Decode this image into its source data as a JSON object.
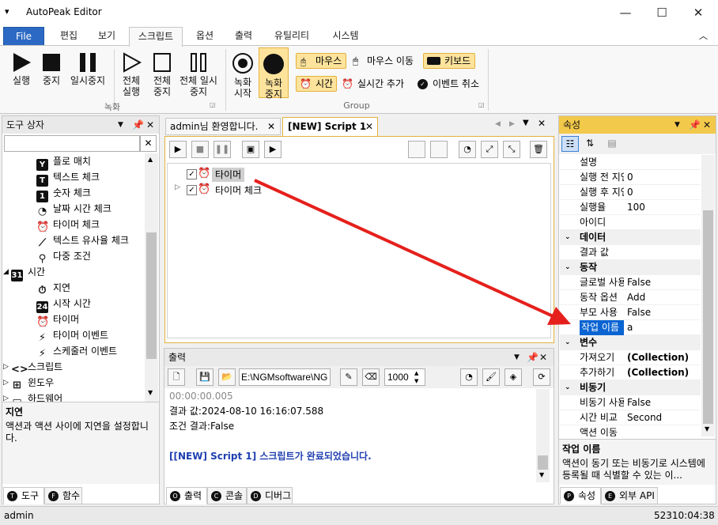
{
  "window": {
    "title": "AutoPeak Editor",
    "min": "—",
    "max": "☐",
    "close": "✕",
    "sysmenu": "▾"
  },
  "ribbon_tabs": [
    "File",
    "편집",
    "보기",
    "스크립트",
    "옵션",
    "출력",
    "유틸리티",
    "시스템"
  ],
  "ribbon": {
    "record_group": "녹화",
    "group2": "Group",
    "buttons": {
      "run": "실행",
      "stop": "중지",
      "pause": "일시중지",
      "all_run": "전체 실행",
      "all_stop": "전체 중지",
      "all_pause": "전체 일시중지",
      "rec_start": "녹화 시작",
      "rec_stop": "녹화 중지"
    },
    "mouse_click": "마우스",
    "mouse_move": "마우스 이동",
    "keyboard": "키보드",
    "time": "시간",
    "realtime_add": "실시간 추가",
    "event_cancel": "이벤트 취소",
    "collapse": "︿"
  },
  "toolbox": {
    "title": "도구 상자",
    "search_value": "",
    "items": [
      {
        "label": "플로 매치",
        "icon": "Y",
        "lv": 2
      },
      {
        "label": "텍스트 체크",
        "icon": "T",
        "lv": 2
      },
      {
        "label": "숫자 체크",
        "icon": "1",
        "lv": 2
      },
      {
        "label": "날짜 시간 체크",
        "icon": "clock",
        "lv": 2
      },
      {
        "label": "타이머 체크",
        "icon": "alarm",
        "lv": 2
      },
      {
        "label": "텍스트 유사율 체크",
        "icon": "sim",
        "lv": 2
      },
      {
        "label": "다중 조건",
        "icon": "multi",
        "lv": 2
      },
      {
        "label": "시간",
        "icon": "31",
        "lv": 1,
        "exp": "◢"
      },
      {
        "label": "지연",
        "icon": "stopwatch",
        "lv": 2
      },
      {
        "label": "시작 시간",
        "icon": "24",
        "lv": 2
      },
      {
        "label": "타이머",
        "icon": "alarm",
        "lv": 2
      },
      {
        "label": "타이머 이벤트",
        "icon": "bolt",
        "lv": 2
      },
      {
        "label": "스케줄러 이벤트",
        "icon": "bolt",
        "lv": 2
      },
      {
        "label": "스크립트",
        "icon": "code",
        "lv": 1,
        "exp": "▷"
      },
      {
        "label": "윈도우",
        "icon": "win",
        "lv": 1,
        "exp": "▷"
      },
      {
        "label": "하드웨어",
        "icon": "hw",
        "lv": 1,
        "exp": "▷"
      }
    ],
    "desc_title": "지연",
    "desc_text": "액션과 액션 사이에 지연을 설정합니다.",
    "tabs": [
      "도구",
      "함수"
    ]
  },
  "doc_tabs": [
    "admin님 환영합니다.",
    "[NEW] Script 1"
  ],
  "script_tree": [
    {
      "label": "타이머",
      "sel": true
    },
    {
      "label": "타이머 체크",
      "sel": false
    }
  ],
  "output": {
    "title": "출력",
    "path": "E:\\NGMsoftware\\NG",
    "spin": "1000",
    "lines": [
      "00:00:00.005",
      "결과 값:2024-08-10 16:16:07.588",
      "조건 결과:False",
      "",
      "[[NEW] Script 1] 스크립트가 완료되었습니다."
    ],
    "tabs": [
      "출력",
      "콘솔",
      "디버그"
    ]
  },
  "props": {
    "title": "속성",
    "rows": [
      {
        "k": "설명",
        "v": ""
      },
      {
        "k": "실행 전 지연",
        "v": "0"
      },
      {
        "k": "실행 후 지연",
        "v": "0"
      },
      {
        "k": "실행율",
        "v": "100"
      },
      {
        "k": "아이디",
        "v": ""
      },
      {
        "cat": "데이터"
      },
      {
        "k": "결과 값",
        "v": ""
      },
      {
        "cat": "동작"
      },
      {
        "k": "글로벌 사용",
        "v": "False"
      },
      {
        "k": "동작 옵션",
        "v": "Add"
      },
      {
        "k": "부모 사용",
        "v": "False"
      },
      {
        "k": "작업 이름",
        "v": "a",
        "sel": true
      },
      {
        "cat": "변수"
      },
      {
        "k": "가져오기",
        "v": "(Collection)",
        "b": true
      },
      {
        "k": "추가하기",
        "v": "(Collection)",
        "b": true
      },
      {
        "cat": "비동기"
      },
      {
        "k": "비동기 사용",
        "v": "False"
      },
      {
        "k": "시간 비교",
        "v": "Second"
      },
      {
        "k": "액션 이동",
        "v": ""
      }
    ],
    "desc_title": "작업 이름",
    "desc_text": "액션이 동기 또는 비동기로 시스템에 등록될 때 식별할 수 있는 이...",
    "tabs": [
      "속성",
      "외부 API"
    ]
  },
  "status": {
    "user": "admin",
    "code": "52310:04:38"
  },
  "colors": {
    "accent": "#2b69c4",
    "highlight": "#f3c94b",
    "arrow": "#e5201c",
    "selection": "#0a64d2"
  }
}
